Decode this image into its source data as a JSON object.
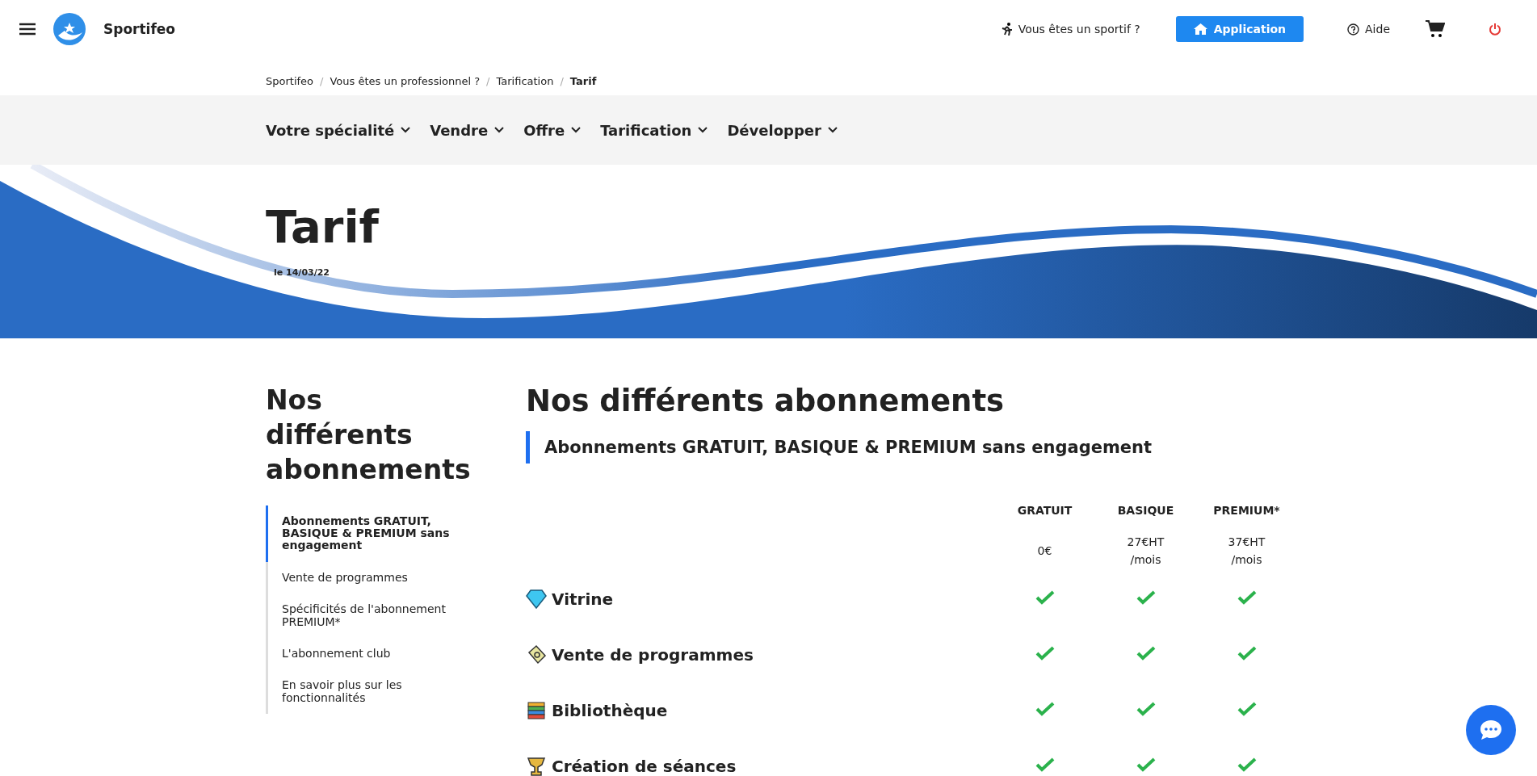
{
  "header": {
    "brand": "Sportifeo",
    "athlete_link": "Vous êtes un sportif ?",
    "app_button": "Application",
    "help_link": "Aide"
  },
  "breadcrumb_separator": "/",
  "breadcrumb": [
    {
      "label": "Sportifeo",
      "current": false
    },
    {
      "label": "Vous êtes un professionnel ?",
      "current": false
    },
    {
      "label": "Tarification",
      "current": false
    },
    {
      "label": "Tarif",
      "current": true
    }
  ],
  "nav": [
    "Votre spécialité",
    "Vendre",
    "Offre",
    "Tarification",
    "Développer"
  ],
  "hero": {
    "title": "Tarif",
    "date": "le 14/03/22"
  },
  "sidebar": {
    "title": "Nos différents abonnements",
    "items": [
      {
        "label": "Abonnements GRATUIT, BASIQUE & PREMIUM sans engagement",
        "selected": true
      },
      {
        "label": "Vente de programmes",
        "selected": false
      },
      {
        "label": "Spécificités de l'abonnement PREMIUM*",
        "selected": false
      },
      {
        "label": "L'abonnement club",
        "selected": false
      },
      {
        "label": "En savoir plus sur les fonctionnalités",
        "selected": false
      }
    ]
  },
  "main": {
    "title": "Nos différents abonnements",
    "section_title": "Abonnements GRATUIT, BASIQUE & PREMIUM sans engagement",
    "plans": [
      {
        "name": "GRATUIT",
        "price": "0€"
      },
      {
        "name": "BASIQUE",
        "price": "27€HT",
        "period": "/mois"
      },
      {
        "name": "PREMIUM*",
        "price": "37€HT",
        "period": "/mois"
      }
    ],
    "features": [
      {
        "kind": "diamond",
        "label": "Vitrine",
        "included": [
          true,
          true,
          true
        ]
      },
      {
        "kind": "ticket",
        "label": "Vente de programmes",
        "included": [
          true,
          true,
          true
        ]
      },
      {
        "kind": "books",
        "label": "Bibliothèque",
        "included": [
          true,
          true,
          true
        ]
      },
      {
        "kind": "trophy",
        "label": "Création de séances",
        "included": [
          true,
          true,
          true
        ]
      }
    ]
  }
}
